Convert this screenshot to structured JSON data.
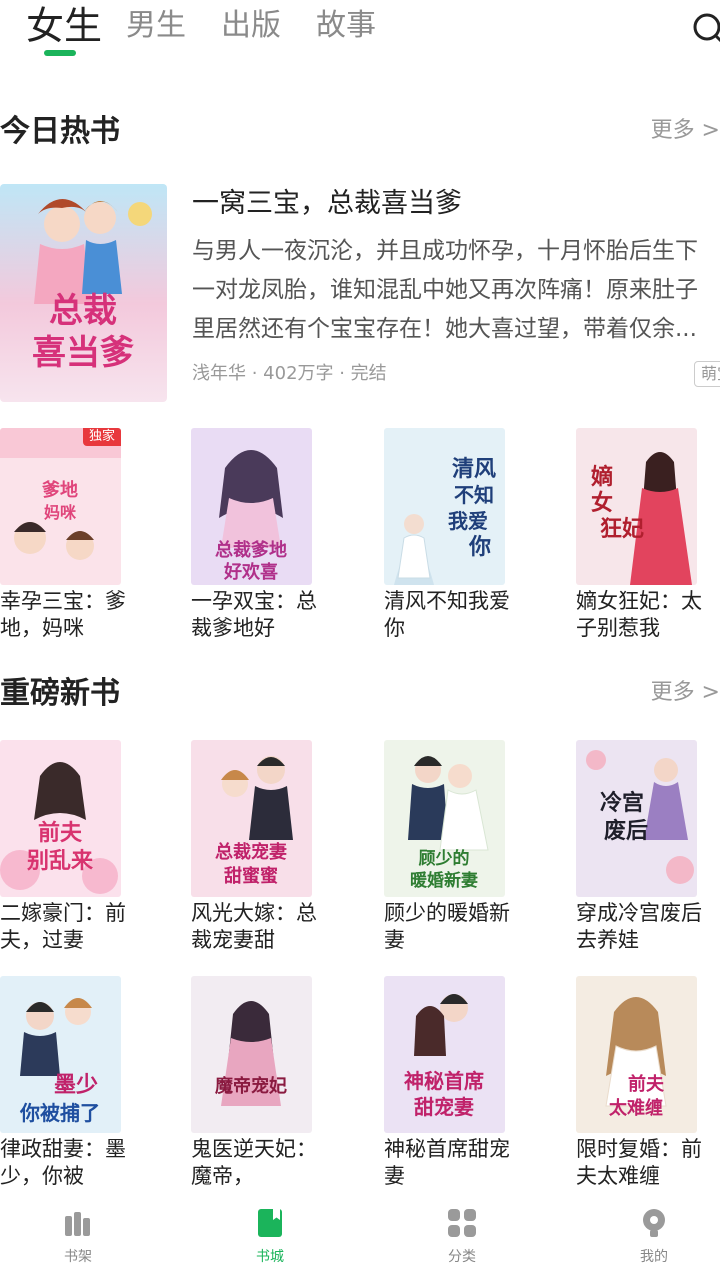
{
  "tabs": [
    {
      "label": "女生",
      "active": true
    },
    {
      "label": "男生",
      "active": false
    },
    {
      "label": "出版",
      "active": false
    },
    {
      "label": "故事",
      "active": false
    }
  ],
  "accent_color": "#1bb45b",
  "icons": {
    "search": "search-icon"
  },
  "sections": {
    "hot": {
      "title": "今日热书",
      "more": "更多 >"
    },
    "new": {
      "title": "重磅新书",
      "more": "更多 >"
    }
  },
  "featured": {
    "title": "一窝三宝，总裁喜当爹",
    "description": "与男人一夜沉沦，并且成功怀孕，十月怀胎后生下一对龙凤胎，谁知混乱中她又再次阵痛！原来肚子里居然还有个宝宝存在！她大喜过望，带着仅余...",
    "meta": "浅年华 · 402万字 · 完结",
    "tag": "萌宝"
  },
  "hot_books": [
    {
      "title": "幸孕三宝：爹地，妈咪",
      "badge": "独家"
    },
    {
      "title": "一孕双宝：总裁爹地好"
    },
    {
      "title": "清风不知我爱你"
    },
    {
      "title": "嫡女狂妃：太子别惹我"
    }
  ],
  "new_books": [
    {
      "title": "二嫁豪门：前夫，过妻"
    },
    {
      "title": "风光大嫁：总裁宠妻甜"
    },
    {
      "title": "顾少的暖婚新妻"
    },
    {
      "title": "穿成冷宫废后去养娃"
    },
    {
      "title": "律政甜妻：墨少，你被"
    },
    {
      "title": "鬼医逆天妃：魔帝，"
    },
    {
      "title": "神秘首席甜宠妻"
    },
    {
      "title": "限时复婚：前夫太难缠"
    }
  ],
  "bottom_nav": [
    {
      "label": "书架",
      "icon": "bookshelf-icon",
      "active": false
    },
    {
      "label": "书城",
      "icon": "bookstore-icon",
      "active": true
    },
    {
      "label": "分类",
      "icon": "category-grid-icon",
      "active": false
    },
    {
      "label": "我的",
      "icon": "profile-icon",
      "active": false
    }
  ]
}
